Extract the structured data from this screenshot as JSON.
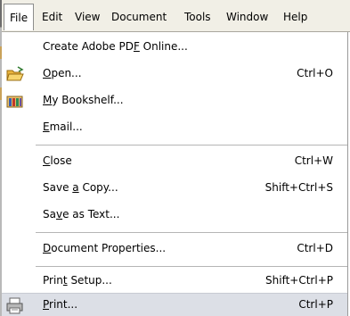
{
  "menubar": {
    "items": [
      "File",
      "Edit",
      "View",
      "Document",
      "Tools",
      "Window",
      "Help"
    ]
  },
  "file_menu": {
    "items": [
      {
        "label": "Create Adobe PDF Online...",
        "shortcut": ""
      },
      {
        "label": "Open...",
        "shortcut": "Ctrl+O",
        "icon": "open-folder-icon"
      },
      {
        "label": "My Bookshelf...",
        "shortcut": "",
        "icon": "bookshelf-icon"
      },
      {
        "label": "Email...",
        "shortcut": ""
      },
      {
        "label": "Close",
        "shortcut": "Ctrl+W"
      },
      {
        "label": "Save a Copy...",
        "shortcut": "Shift+Ctrl+S"
      },
      {
        "label": "Save as Text...",
        "shortcut": ""
      },
      {
        "label": "Document Properties...",
        "shortcut": "Ctrl+D"
      },
      {
        "label": "Print Setup...",
        "shortcut": "Shift+Ctrl+P"
      },
      {
        "label": "Print...",
        "shortcut": "Ctrl+P",
        "icon": "printer-icon"
      }
    ]
  },
  "colors": {
    "menubar_bg": "#f1efe6",
    "highlight_bg": "#dcdfe6"
  }
}
